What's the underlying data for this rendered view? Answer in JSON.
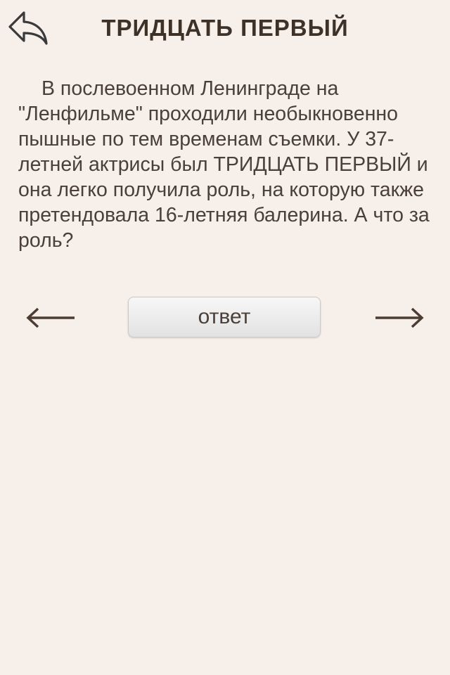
{
  "header": {
    "title": "ТРИДЦАТЬ ПЕРВЫЙ",
    "back_icon": "back-arrow-icon"
  },
  "question": {
    "text": "В послевоенном Ленинграде на \"Ленфильме\" проходили необыкновенно пышные по тем временам съемки. У 37-летней актрисы был ТРИДЦАТЬ ПЕРВЫЙ и она легко получила роль, на которую также претендовала 16-летняя балерина. А что за роль?"
  },
  "controls": {
    "prev_icon": "arrow-left-icon",
    "answer_label": "ответ",
    "next_icon": "arrow-right-icon"
  },
  "colors": {
    "background": "#f7efea",
    "text": "#4a4039",
    "title": "#3e3128",
    "arrow": "#4d3c31"
  }
}
